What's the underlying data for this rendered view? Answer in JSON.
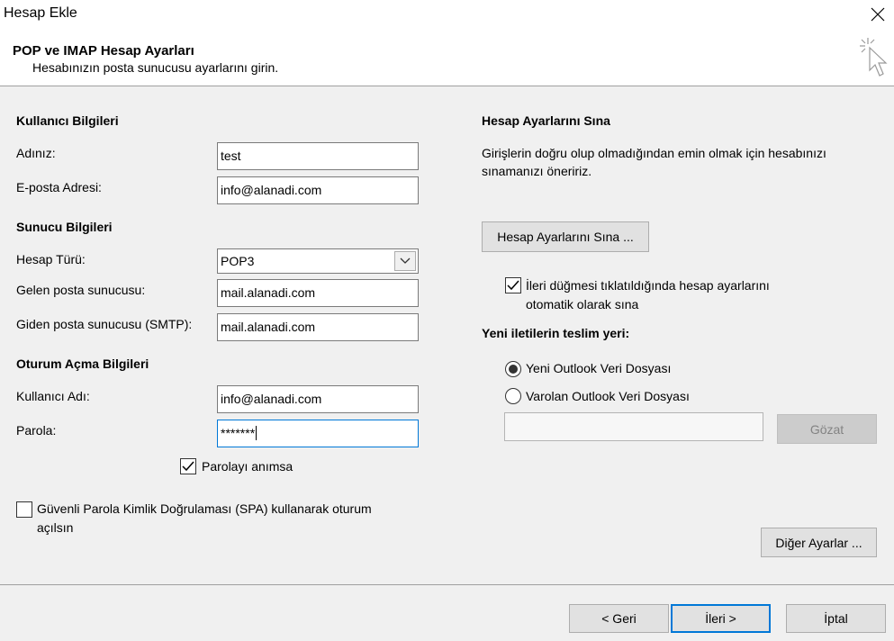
{
  "window": {
    "title": "Hesap Ekle"
  },
  "header": {
    "title": "POP ve IMAP Hesap Ayarları",
    "subtitle": "Hesabınızın posta sunucusu ayarlarını girin."
  },
  "user_info": {
    "heading": "Kullanıcı Bilgileri",
    "name_label": "Adınız:",
    "name_value": "test",
    "email_label": "E-posta Adresi:",
    "email_value": "info@alanadi.com"
  },
  "server_info": {
    "heading": "Sunucu Bilgileri",
    "account_type_label": "Hesap Türü:",
    "account_type_value": "POP3",
    "incoming_label": "Gelen posta sunucusu:",
    "incoming_value": "mail.alanadi.com",
    "outgoing_label": "Giden posta sunucusu (SMTP):",
    "outgoing_value": "mail.alanadi.com"
  },
  "logon_info": {
    "heading": "Oturum Açma Bilgileri",
    "username_label": "Kullanıcı Adı:",
    "username_value": "info@alanadi.com",
    "password_label": "Parola:",
    "password_value": "*******",
    "remember_label": "Parolayı anımsa",
    "remember_checked": true,
    "spa_label_line1": "Güvenli Parola Kimlik Doğrulaması (SPA) kullanarak oturum",
    "spa_label_line2": "açılsın",
    "spa_checked": false
  },
  "test_settings": {
    "heading": "Hesap Ayarlarını Sına",
    "description_line1": "Girişlerin doğru olup olmadığından emin olmak için hesabınızı",
    "description_line2": "sınamanızı öneririz.",
    "test_button": "Hesap Ayarlarını Sına ...",
    "auto_test_line1": "İleri düğmesi tıklatıldığında hesap ayarlarını",
    "auto_test_line2": "otomatik olarak sına",
    "auto_test_checked": true
  },
  "delivery": {
    "heading": "Yeni iletilerin teslim yeri:",
    "new_file_label": "Yeni Outlook Veri Dosyası",
    "existing_file_label": "Varolan Outlook Veri Dosyası",
    "selected": "new",
    "file_path_value": "",
    "browse_button": "Gözat"
  },
  "buttons": {
    "more_settings": "Diğer Ayarlar ...",
    "back": "< Geri",
    "next": "İleri >",
    "cancel": "İptal"
  }
}
